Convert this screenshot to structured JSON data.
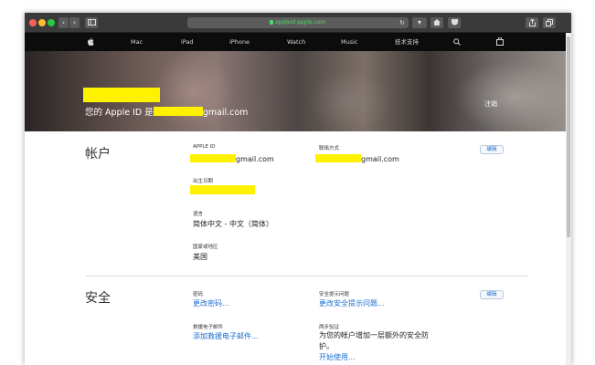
{
  "browser": {
    "address": "appleid.apple.com",
    "icons": [
      "back-icon",
      "forward-icon",
      "sidebar-icon",
      "lock-icon",
      "reload-icon",
      "download-icon",
      "home-icon",
      "pocket-icon",
      "share-icon",
      "tabs-icon"
    ]
  },
  "nav": {
    "items": [
      "Mac",
      "iPad",
      "iPhone",
      "Watch",
      "Music",
      "技术支持"
    ]
  },
  "hero": {
    "apple_id_prefix": "您的 Apple ID 是",
    "apple_id_suffix": "gmail.com",
    "logout": "注销"
  },
  "account": {
    "title": "帐户",
    "edit": "编辑",
    "apple_id_label": "APPLE ID",
    "apple_id_suffix": "gmail.com",
    "contact_label": "联络方式",
    "contact_suffix": "gmail.com",
    "birthday_label": "出生日期",
    "language_label": "语言",
    "language_value": "简体中文 - 中文（简体）",
    "region_label": "国家或地区",
    "region_value": "美国"
  },
  "security": {
    "title": "安全",
    "edit": "编辑",
    "password_label": "密码",
    "password_link": "更改密码...",
    "questions_label": "安全提示问题",
    "questions_link": "更改安全提示问题...",
    "rescue_label": "救援电子邮件",
    "rescue_link": "添加救援电子邮件...",
    "twostep_label": "两步验证",
    "twostep_text": "为您的帐户增加一层额外的安全防护。",
    "twostep_link": "开始使用..."
  },
  "colors": {
    "redaction": "#fff200",
    "link": "#1a6fd0",
    "nav_bg": "#0c0c0c"
  }
}
